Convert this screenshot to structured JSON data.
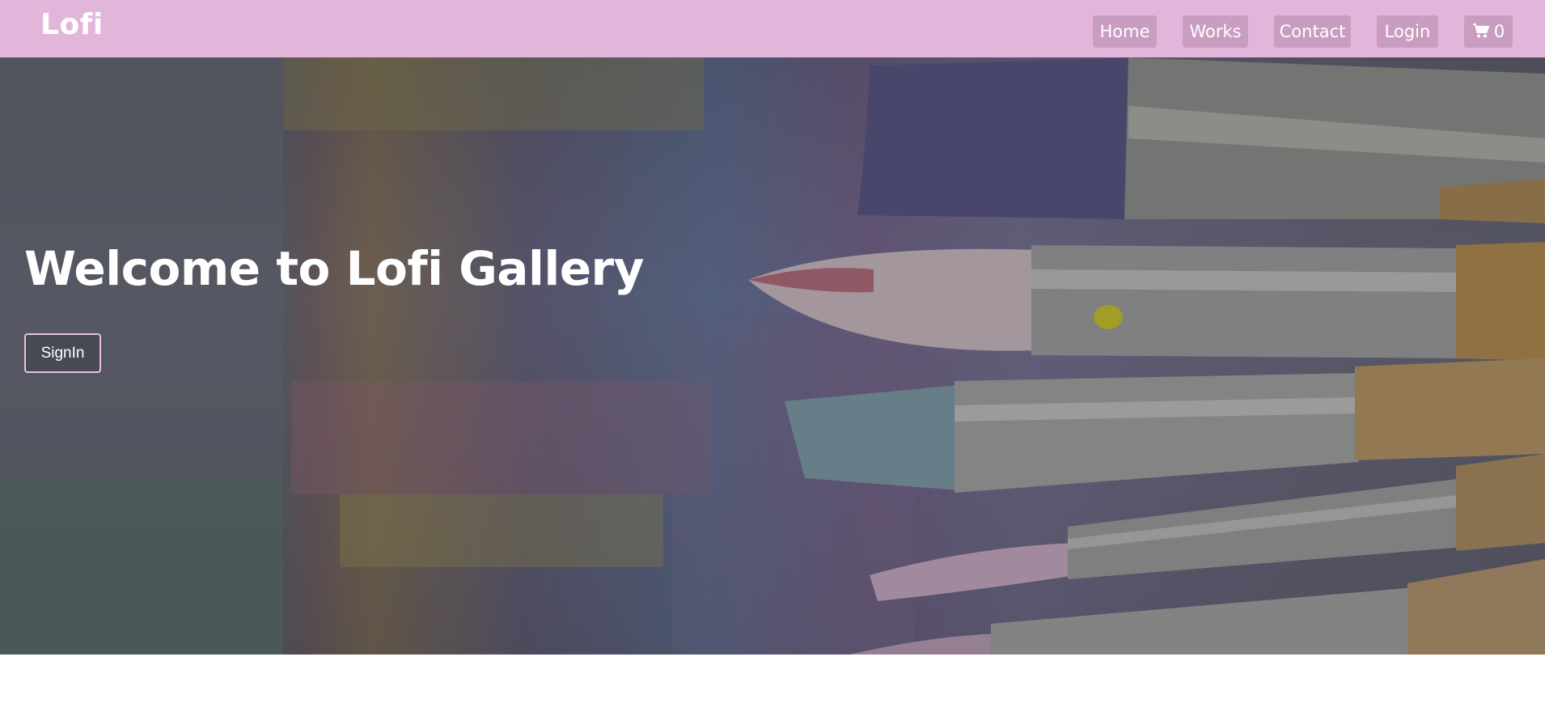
{
  "navbar": {
    "brand": "Lofi",
    "background": "#e2b6da",
    "button_color": "#c99dbf",
    "links": [
      {
        "label": "Home"
      },
      {
        "label": "Works"
      },
      {
        "label": "Contact"
      },
      {
        "label": "Login"
      }
    ],
    "cart": {
      "icon": "shopping-cart-icon",
      "count": "0"
    }
  },
  "hero": {
    "title": "Welcome to Lofi Gallery",
    "signin_label": "SignIn",
    "background_image": "paint-brushes-photo"
  }
}
